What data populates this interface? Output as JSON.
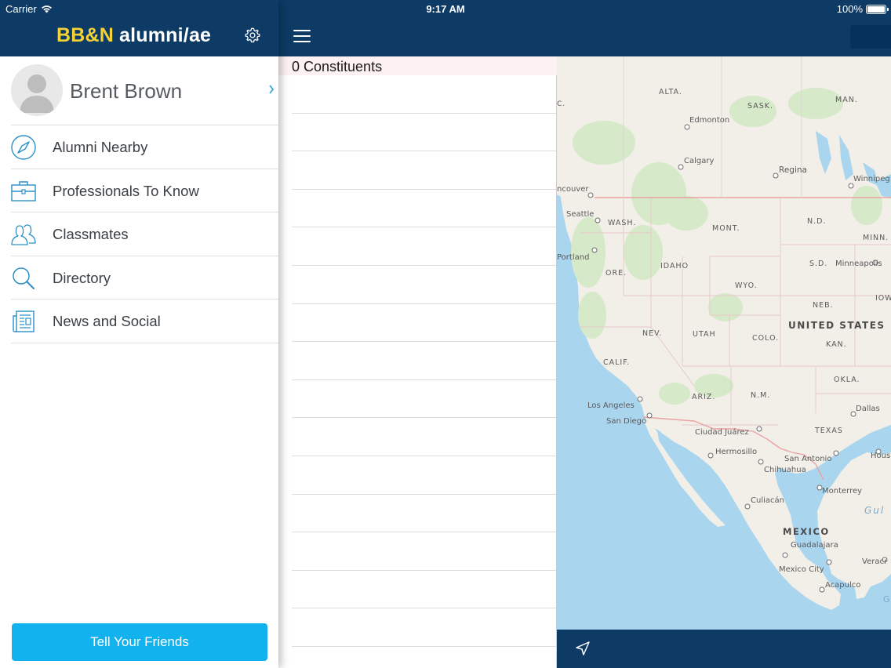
{
  "status_bar": {
    "carrier": "Carrier",
    "time": "9:17 AM",
    "battery": "100%"
  },
  "menu": {
    "brand_accent": "BB&N",
    "brand_rest": "alumni/ae",
    "profile_name": "Brent Brown",
    "items": [
      {
        "label": "Alumni Nearby",
        "icon": "compass-icon"
      },
      {
        "label": "Professionals To Know",
        "icon": "briefcase-icon"
      },
      {
        "label": "Classmates",
        "icon": "people-icon"
      },
      {
        "label": "Directory",
        "icon": "search-icon"
      },
      {
        "label": "News and Social",
        "icon": "newspaper-icon"
      }
    ],
    "tell_friends_label": "Tell Your Friends"
  },
  "list": {
    "count_label": "0 Constituents"
  },
  "map": {
    "labels": {
      "c": "C.",
      "alta": "ALTA.",
      "sask": "SASK.",
      "man": "MAN.",
      "edmonton": "Edmonton",
      "calgary": "Calgary",
      "regina": "Regina",
      "winnipeg": "Winnipeg",
      "vancouver": "ncouver",
      "seattle": "Seattle",
      "wash": "WASH.",
      "mont": "MONT.",
      "nd": "N.D.",
      "minn": "MINN.",
      "portland": "Portland",
      "ore": "ORE.",
      "idaho": "IDAHO",
      "sd": "S.D.",
      "minneapolis": "Minneapolis",
      "wyo": "WYO.",
      "iow": "IOW",
      "neb": "NEB.",
      "united_states": "UNITED STATES",
      "nev": "NEV.",
      "utah": "UTAH",
      "colo": "COLO.",
      "kan": "KAN.",
      "calif": "CALIF.",
      "okla": "OKLA.",
      "ariz": "ARIZ.",
      "nm": "N.M.",
      "los_angeles": "Los Angeles",
      "dallas": "Dallas",
      "san_diego": "San Diego",
      "ciudad_juarez": "Ciudad Juárez",
      "texas": "TEXAS",
      "hermosillo": "Hermosillo",
      "san_antonio": "San Antonio",
      "hous": "Hous",
      "chihuahua": "Chihuahua",
      "monterrey": "Monterrey",
      "culiacan": "Culiacán",
      "gul": "Gul",
      "mexico": "MEXICO",
      "guadalajara": "Guadalajara",
      "veracr": "Veracr",
      "mexico_city": "Mexico City",
      "acapulco": "Acapulco",
      "g": "G"
    }
  }
}
